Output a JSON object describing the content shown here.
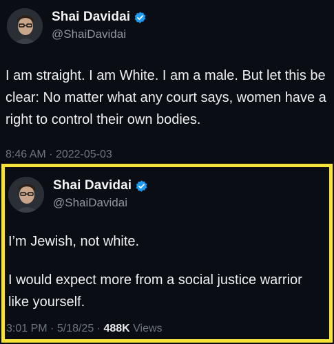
{
  "tweets": [
    {
      "author": {
        "name": "Shai Davidai",
        "handle": "@ShaiDavidai",
        "verified": true,
        "avatar_icon": "profile-photo"
      },
      "text": "I am straight. I am White. I am a male. But let this be clear: No matter what any court says, women have a right to control their own bodies.",
      "time": "8:46 AM",
      "separator": "·",
      "date": "2022-05-03"
    },
    {
      "author": {
        "name": "Shai Davidai",
        "handle": "@ShaiDavidai",
        "verified": true,
        "avatar_icon": "profile-photo"
      },
      "paragraphs": [
        "I’m Jewish, not white.",
        "I would expect more from a social justice warrior like yourself."
      ],
      "time": "3:01 PM",
      "separator": "·",
      "date": "5/18/25",
      "separator_2": "·",
      "views_count": "488K",
      "views_label": "Views",
      "highlight_color": "#f5e33c"
    }
  ],
  "colors": {
    "background": "#0a0d14",
    "verified_badge": "#1d9bf0",
    "highlight_border": "#f5e33c",
    "secondary_text": "#6e767d"
  }
}
